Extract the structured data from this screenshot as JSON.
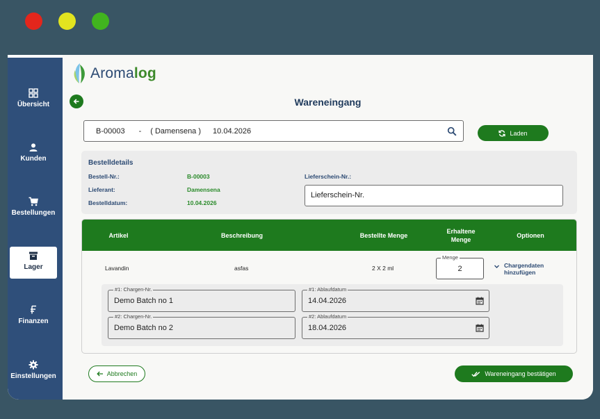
{
  "app": {
    "name_part1": "Aroma",
    "name_part2": "log",
    "colors": {
      "accent": "#1e7a1e",
      "sidebar": "#2f4f7a",
      "text_blue": "#2c4a73",
      "value_green": "#2a8a2a"
    }
  },
  "window_controls": [
    "close",
    "minimize",
    "maximize"
  ],
  "sidebar": {
    "items": [
      {
        "label": "Übersicht",
        "icon": "grid-icon",
        "active": false
      },
      {
        "label": "Kunden",
        "icon": "person-icon",
        "active": false
      },
      {
        "label": "Bestellungen",
        "icon": "cart-icon",
        "active": false
      },
      {
        "label": "Lager",
        "icon": "archive-icon",
        "active": true
      },
      {
        "label": "Finanzen",
        "icon": "currency-icon",
        "active": false
      },
      {
        "label": "Einstellungen",
        "icon": "gear-icon",
        "active": false
      }
    ]
  },
  "page": {
    "title": "Wareneingang"
  },
  "search": {
    "order_no": "B-00003",
    "separator": "-",
    "customer": "( Damensena )",
    "date": "10.04.2026",
    "load_label": "Laden"
  },
  "details": {
    "title": "Bestelldetails",
    "order_no_label": "Bestell-Nr.:",
    "order_no_value": "B-00003",
    "supplier_label": "Lieferant:",
    "supplier_value": "Damensena",
    "order_date_label": "Bestelldatum:",
    "order_date_value": "10.04.2026",
    "delivery_note_label": "Lieferschein-Nr.:",
    "delivery_note_placeholder": "Lieferschein-Nr."
  },
  "table": {
    "headers": {
      "article": "Artikel",
      "description": "Beschreibung",
      "ordered_qty": "Bestellte Menge",
      "received_qty_line1": "Erhaltene",
      "received_qty_line2": "Menge",
      "options": "Optionen"
    },
    "row": {
      "article": "Lavandin",
      "description": "asfas",
      "ordered_qty": "2 X 2 ml",
      "qty_label": "Menge",
      "qty_value": "2",
      "batch_link_line1": "Chargendaten",
      "batch_link_line2": "hinzufügen"
    },
    "batches": [
      {
        "batch_label": "#1: Chargen-Nr.",
        "batch_value": "Demo Batch no 1",
        "expiry_label": "#1: Ablaufdatum",
        "expiry_value": "14.04.2026"
      },
      {
        "batch_label": "#2: Chargen-Nr.",
        "batch_value": "Demo Batch no 2",
        "expiry_label": "#2: Ablaufdatum",
        "expiry_value": "18.04.2026"
      }
    ]
  },
  "footer": {
    "cancel_label": "Abbrechen",
    "confirm_label": "Wareneingang bestätigen"
  }
}
